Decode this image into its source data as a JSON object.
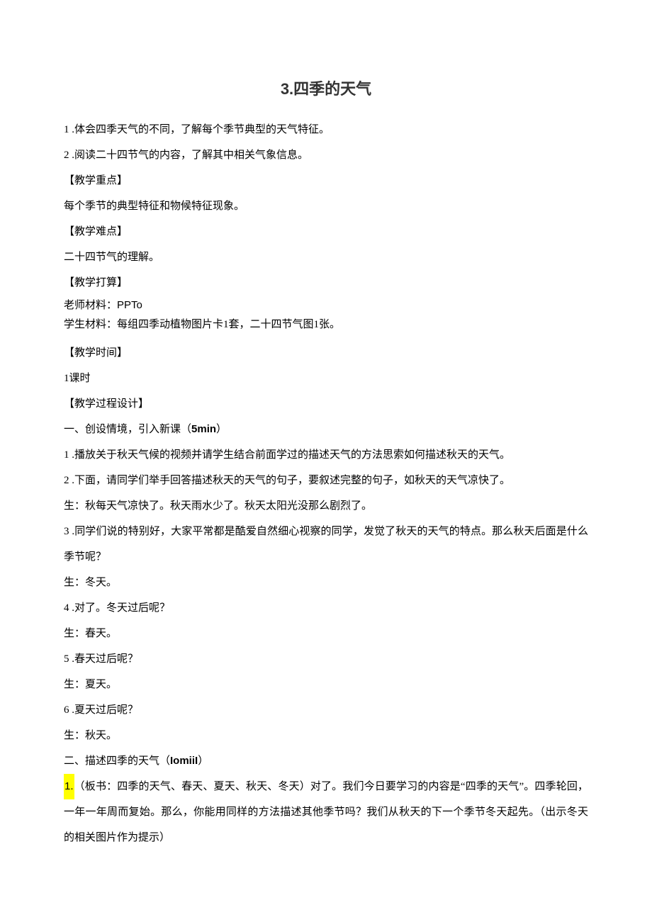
{
  "title_num": "3.",
  "title_text": "四季的天气",
  "lines": {
    "l1": "1 .体会四季天气的不同，了解每个季节典型的天气特征。",
    "l2": "2 .阅读二十四节气的内容，了解其中相关气象信息。",
    "l3": "【教学重点】",
    "l4": "每个季节的典型特征和物候特征现象。",
    "l5": "【教学难点】",
    "l6": "二十四节气的理解。",
    "l7": "【教学打算】",
    "l8a": "老师材料：",
    "l8b": "PPTo",
    "l9": "学生材料：每组四季动植物图片卡1套，二十四节气图1张。",
    "l10": "【教学时间】",
    "l11": "1课时",
    "l12": "【教学过程设计】",
    "l13a": "一、创设情境，引入新课（",
    "l13b": "5min",
    "l13c": "）",
    "l14": "1 .播放关于秋天气候的视频并请学生结合前面学过的描述天气的方法思索如何描述秋天的天气。",
    "l15": "2 .下面，请同学们举手回答描述秋天的天气的句子，要叙述完整的句子，如秋天的天气凉快了。",
    "l16": "生：秋每天气凉快了。秋天雨水少了。秋天太阳光没那么剧烈了。",
    "l17": "3 .同学们说的特别好，大家平常都是酷爱自然细心视察的同学，发觉了秋天的天气的特点。那么秋天后面是什么季节呢？",
    "l18": "生：冬天。",
    "l19": "4 .对了。冬天过后呢？",
    "l20": "生：春天。",
    "l21": "5 .春天过后呢？",
    "l22": "生：夏天。",
    "l23": "6 .夏天过后呢？",
    "l24": "生：秋天。",
    "l25a": "二、描述四季的天气（",
    "l25b": "IomiiI",
    "l25c": "）",
    "l26a": "1.",
    "l26b": "（板书：四季的天气、春天、夏天、秋天、冬天）对了。我们今日要学习的内容是“四季的天气”。四季轮回，一年一年周而复始。那么，你能用同样的方法描述其他季节吗？我们从秋天的下一个季节冬天起先。（出示冬天的相关图片作为提示）"
  }
}
